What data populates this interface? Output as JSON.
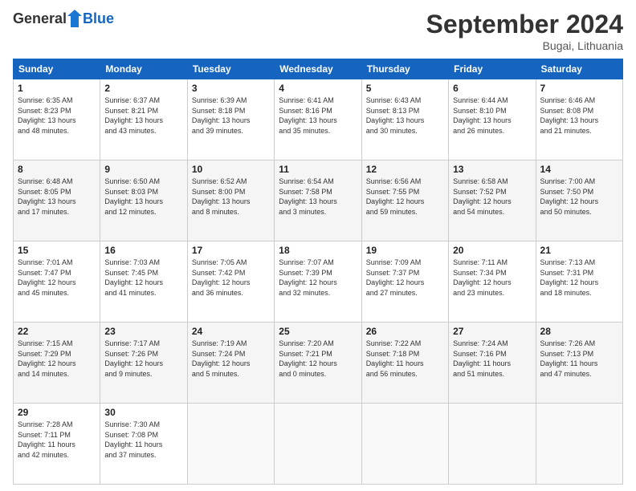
{
  "header": {
    "logo_general": "General",
    "logo_blue": "Blue",
    "month_title": "September 2024",
    "location": "Bugai, Lithuania"
  },
  "calendar": {
    "headers": [
      "Sunday",
      "Monday",
      "Tuesday",
      "Wednesday",
      "Thursday",
      "Friday",
      "Saturday"
    ],
    "weeks": [
      [
        {
          "day": "",
          "info": ""
        },
        {
          "day": "2",
          "info": "Sunrise: 6:37 AM\nSunset: 8:21 PM\nDaylight: 13 hours\nand 43 minutes."
        },
        {
          "day": "3",
          "info": "Sunrise: 6:39 AM\nSunset: 8:18 PM\nDaylight: 13 hours\nand 39 minutes."
        },
        {
          "day": "4",
          "info": "Sunrise: 6:41 AM\nSunset: 8:16 PM\nDaylight: 13 hours\nand 35 minutes."
        },
        {
          "day": "5",
          "info": "Sunrise: 6:43 AM\nSunset: 8:13 PM\nDaylight: 13 hours\nand 30 minutes."
        },
        {
          "day": "6",
          "info": "Sunrise: 6:44 AM\nSunset: 8:10 PM\nDaylight: 13 hours\nand 26 minutes."
        },
        {
          "day": "7",
          "info": "Sunrise: 6:46 AM\nSunset: 8:08 PM\nDaylight: 13 hours\nand 21 minutes."
        }
      ],
      [
        {
          "day": "8",
          "info": "Sunrise: 6:48 AM\nSunset: 8:05 PM\nDaylight: 13 hours\nand 17 minutes."
        },
        {
          "day": "9",
          "info": "Sunrise: 6:50 AM\nSunset: 8:03 PM\nDaylight: 13 hours\nand 12 minutes."
        },
        {
          "day": "10",
          "info": "Sunrise: 6:52 AM\nSunset: 8:00 PM\nDaylight: 13 hours\nand 8 minutes."
        },
        {
          "day": "11",
          "info": "Sunrise: 6:54 AM\nSunset: 7:58 PM\nDaylight: 13 hours\nand 3 minutes."
        },
        {
          "day": "12",
          "info": "Sunrise: 6:56 AM\nSunset: 7:55 PM\nDaylight: 12 hours\nand 59 minutes."
        },
        {
          "day": "13",
          "info": "Sunrise: 6:58 AM\nSunset: 7:52 PM\nDaylight: 12 hours\nand 54 minutes."
        },
        {
          "day": "14",
          "info": "Sunrise: 7:00 AM\nSunset: 7:50 PM\nDaylight: 12 hours\nand 50 minutes."
        }
      ],
      [
        {
          "day": "15",
          "info": "Sunrise: 7:01 AM\nSunset: 7:47 PM\nDaylight: 12 hours\nand 45 minutes."
        },
        {
          "day": "16",
          "info": "Sunrise: 7:03 AM\nSunset: 7:45 PM\nDaylight: 12 hours\nand 41 minutes."
        },
        {
          "day": "17",
          "info": "Sunrise: 7:05 AM\nSunset: 7:42 PM\nDaylight: 12 hours\nand 36 minutes."
        },
        {
          "day": "18",
          "info": "Sunrise: 7:07 AM\nSunset: 7:39 PM\nDaylight: 12 hours\nand 32 minutes."
        },
        {
          "day": "19",
          "info": "Sunrise: 7:09 AM\nSunset: 7:37 PM\nDaylight: 12 hours\nand 27 minutes."
        },
        {
          "day": "20",
          "info": "Sunrise: 7:11 AM\nSunset: 7:34 PM\nDaylight: 12 hours\nand 23 minutes."
        },
        {
          "day": "21",
          "info": "Sunrise: 7:13 AM\nSunset: 7:31 PM\nDaylight: 12 hours\nand 18 minutes."
        }
      ],
      [
        {
          "day": "22",
          "info": "Sunrise: 7:15 AM\nSunset: 7:29 PM\nDaylight: 12 hours\nand 14 minutes."
        },
        {
          "day": "23",
          "info": "Sunrise: 7:17 AM\nSunset: 7:26 PM\nDaylight: 12 hours\nand 9 minutes."
        },
        {
          "day": "24",
          "info": "Sunrise: 7:19 AM\nSunset: 7:24 PM\nDaylight: 12 hours\nand 5 minutes."
        },
        {
          "day": "25",
          "info": "Sunrise: 7:20 AM\nSunset: 7:21 PM\nDaylight: 12 hours\nand 0 minutes."
        },
        {
          "day": "26",
          "info": "Sunrise: 7:22 AM\nSunset: 7:18 PM\nDaylight: 11 hours\nand 56 minutes."
        },
        {
          "day": "27",
          "info": "Sunrise: 7:24 AM\nSunset: 7:16 PM\nDaylight: 11 hours\nand 51 minutes."
        },
        {
          "day": "28",
          "info": "Sunrise: 7:26 AM\nSunset: 7:13 PM\nDaylight: 11 hours\nand 47 minutes."
        }
      ],
      [
        {
          "day": "29",
          "info": "Sunrise: 7:28 AM\nSunset: 7:11 PM\nDaylight: 11 hours\nand 42 minutes."
        },
        {
          "day": "30",
          "info": "Sunrise: 7:30 AM\nSunset: 7:08 PM\nDaylight: 11 hours\nand 37 minutes."
        },
        {
          "day": "",
          "info": ""
        },
        {
          "day": "",
          "info": ""
        },
        {
          "day": "",
          "info": ""
        },
        {
          "day": "",
          "info": ""
        },
        {
          "day": "",
          "info": ""
        }
      ]
    ],
    "first_day": {
      "day": "1",
      "info": "Sunrise: 6:35 AM\nSunset: 8:23 PM\nDaylight: 13 hours\nand 48 minutes."
    }
  }
}
